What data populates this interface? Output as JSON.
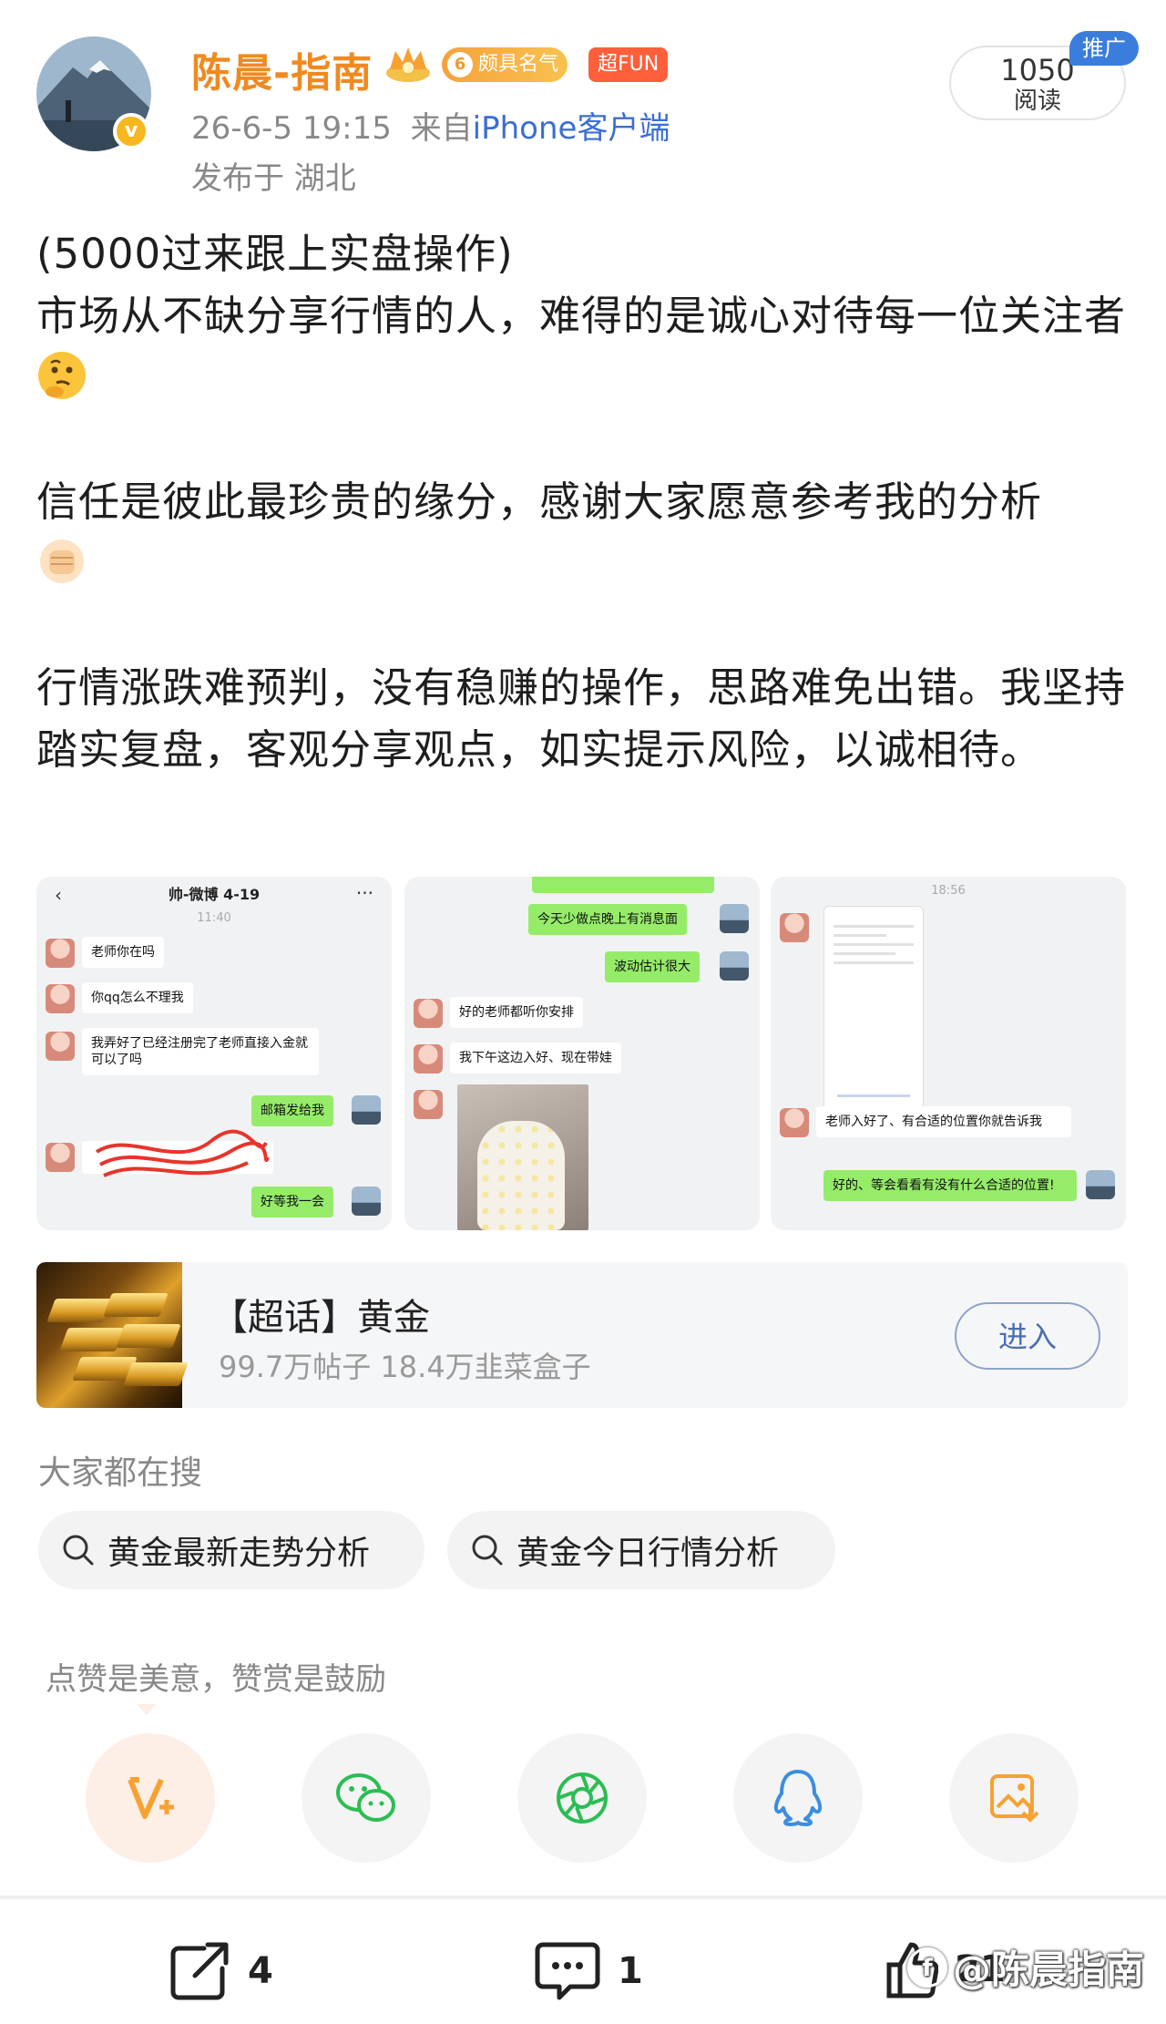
{
  "header": {
    "username": "陈晨-指南",
    "level_badge": "颇具名气",
    "level_number": "6",
    "fun_badge": "超FUN",
    "date": "26-6-5 19:15",
    "source_prefix": "来自",
    "source_client": "iPhone客户端",
    "location": "发布于 湖北",
    "read_count": "1050",
    "read_label": "阅读",
    "promo_label": "推广"
  },
  "post": {
    "p1_line1": "(5000过来跟上实盘操作)",
    "p1_line2": "市场从不缺分享行情的人，难得的是诚心对待每一位关注者",
    "p2": "信任是彼此最珍贵的缘分，感谢大家愿意参考我的分析",
    "p3": "行情涨跌难预判，没有稳赚的操作，思路难免出错。我坚持踏实复盘，客观分享观点，如实提示风险，以诚相待。",
    "emoji1": "thinking-face",
    "emoji2": "raised-fist"
  },
  "screenshots": {
    "s1": {
      "title": "帅-微博 4-19",
      "time": "11:40",
      "msgs": [
        "老师你在吗",
        "你qq怎么不理我",
        "我弄好了已经注册完了老师直接入金就可以了吗",
        "邮箱发给我",
        "好等我一会"
      ]
    },
    "s2": {
      "msgs": [
        "今天少做点晚上有消息面",
        "波动估计很大",
        "好的老师都听你安排",
        "我下午这边入好、现在带娃"
      ]
    },
    "s3": {
      "time": "18:56",
      "msgs": [
        "老师入好了、有合适的位置你就告诉我",
        "好的、等会看看有没有什么合适的位置!"
      ]
    }
  },
  "topic": {
    "title": "【超话】黄金",
    "stats": "99.7万帖子 18.4万韭菜盒子",
    "enter_label": "进入"
  },
  "search": {
    "heading": "大家都在搜",
    "chips": [
      "黄金最新走势分析",
      "黄金今日行情分析"
    ]
  },
  "share": {
    "note": "点赞是美意，赞赏是鼓励",
    "icons": [
      "v-plus-icon",
      "wechat-icon",
      "moments-icon",
      "qq-icon",
      "save-image-icon"
    ]
  },
  "actions": {
    "repost_count": "4",
    "comment_count": "1",
    "like_count": "21",
    "watermark": "@陈晨指南"
  },
  "colors": {
    "username": "#f08a20",
    "link": "#3b6ed4",
    "wechat_green": "#2bbd54",
    "qq_blue": "#3b8ee0",
    "accent_orange": "#f6a233"
  }
}
